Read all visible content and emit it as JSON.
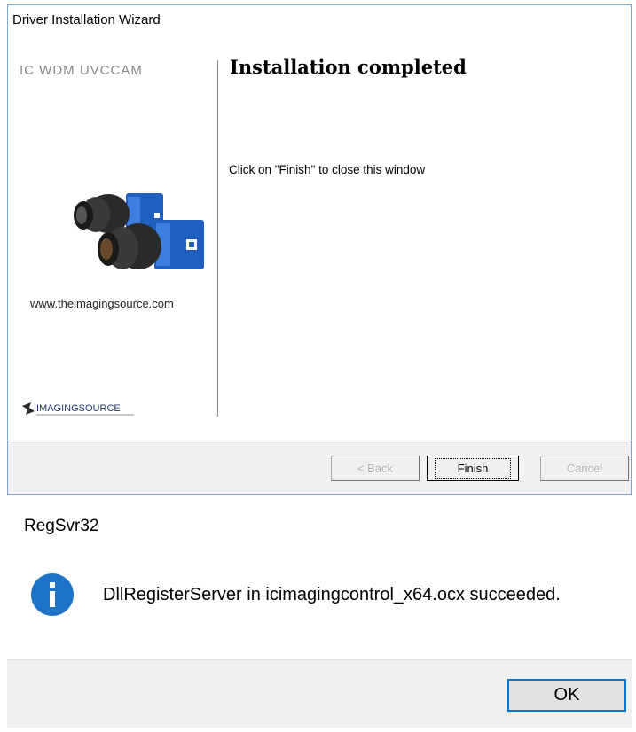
{
  "wizard": {
    "title": "Driver Installation Wizard",
    "product_name": "IC WDM UVCCAM",
    "website": "www.theimagingsource.com",
    "logo_text": "IMAGINGSOURCE",
    "heading": "Installation completed",
    "instruction": "Click on \"Finish\" to close this window",
    "buttons": {
      "back": "< Back",
      "finish": "Finish",
      "cancel": "Cancel"
    }
  },
  "dialog": {
    "title": "RegSvr32",
    "message": "DllRegisterServer in icimagingcontrol_x64.ocx succeeded.",
    "ok_label": "OK",
    "icon": "info-icon"
  },
  "colors": {
    "accent": "#0078d7",
    "info_icon": "#1e73c8",
    "camera_body": "#1f5fbf"
  }
}
